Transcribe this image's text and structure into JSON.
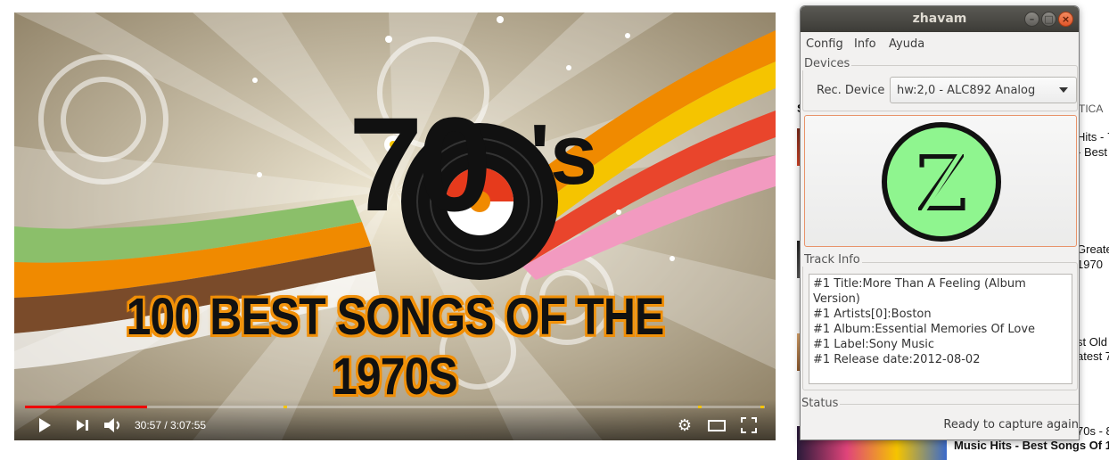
{
  "video": {
    "title_line": "100 BEST SONGS OF THE 1970S",
    "logo_main": "70",
    "logo_suffix": "'s",
    "time_display": "30:57 / 3:07:55",
    "progress_fraction": 0.165,
    "controls": {
      "play_icon": "play-icon",
      "next_icon": "next-icon",
      "volume_icon": "volume-icon",
      "settings_icon": "gear-icon",
      "theater_icon": "theater-mode-icon",
      "fullscreen_icon": "fullscreen-icon"
    },
    "accent_color": "#e00000"
  },
  "sidebar": {
    "header_fragment": "S",
    "header_right": "TICA",
    "items": [
      {
        "line1": "Hits - 7",
        "line2": "- Best"
      },
      {
        "line1": "Greate",
        "line2": "1970"
      },
      {
        "line1": "st Old",
        "line2": "atest 7"
      },
      {
        "line1": "70s - 8",
        "line2": "Music Hits - Best Songs Of 1"
      }
    ]
  },
  "zhavam": {
    "window_title": "zhavam",
    "menu": [
      "Config",
      "Info",
      "Ayuda"
    ],
    "devices_label": "Devices",
    "rec_device_label": "Rec. Device",
    "rec_device_value": "hw:2,0 - ALC892 Analog",
    "logo_letter": "Z",
    "logo_color": "#8ff58f",
    "track_info_label": "Track Info",
    "track_lines": [
      "#1 Title:More Than A Feeling (Album",
      "Version)",
      "#1 Artists[0]:Boston",
      "#1 Album:Essential Memories Of Love",
      "#1 Label:Sony Music",
      "#1 Release date:2012-08-02"
    ],
    "status_label": "Status",
    "status_text": "Ready to capture again"
  }
}
